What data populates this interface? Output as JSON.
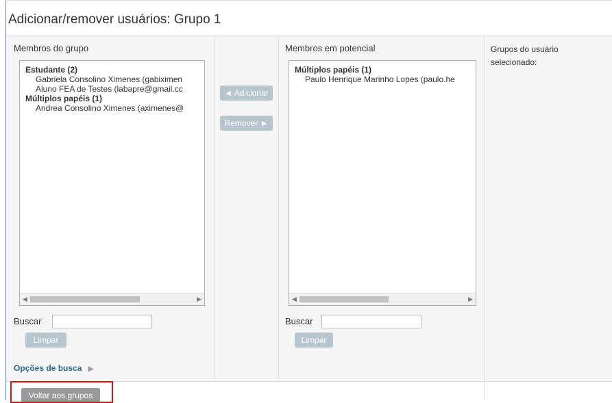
{
  "page": {
    "title": "Adicionar/remover usuários: Grupo 1"
  },
  "members": {
    "label": "Membros do grupo",
    "groups": [
      {
        "label": "Estudante (2)",
        "items": [
          "Gabriela Consolino Ximenes (gabiximen",
          "Aluno FEA de Testes (labapre@gmail.cc"
        ]
      },
      {
        "label": "Múltiplos papéis (1)",
        "items": [
          "Andrea Consolino Ximenes (aximenes@"
        ]
      }
    ],
    "search_label": "Buscar",
    "search_value": "",
    "clear_label": "Limpar",
    "options_label": "Opções de busca"
  },
  "actions": {
    "add_label": "◄ Adicionar",
    "remove_label": "Remover ►"
  },
  "potential": {
    "label": "Membros em potencial",
    "groups": [
      {
        "label": "Múltiplos papéis (1)",
        "items": [
          "Paulo Henrique Marinho Lopes (paulo.he"
        ]
      }
    ],
    "search_label": "Buscar",
    "search_value": "",
    "clear_label": "Limpar"
  },
  "user_groups": {
    "label": "Grupos do usuário selecionado:"
  },
  "footer": {
    "back_label": "Voltar aos grupos"
  },
  "colors": {
    "highlight_box": "#e01010",
    "disabled_button": "#b6c5ce",
    "link": "#2b6c8f"
  }
}
